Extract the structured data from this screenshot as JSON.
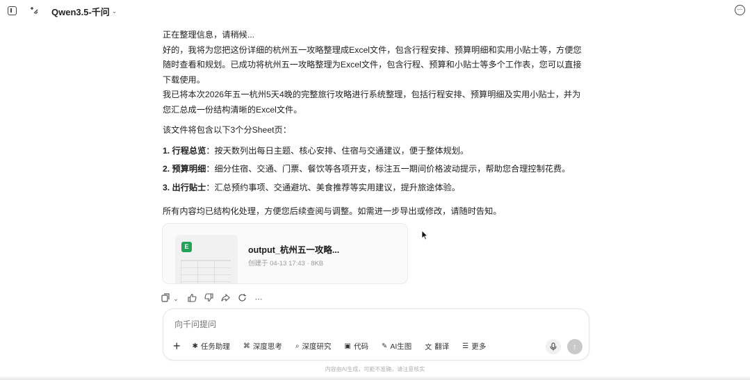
{
  "topbar": {
    "model_name": "Qwen3.5-千问",
    "chevron": "⌄",
    "icons": [
      "sidebar-toggle-icon",
      "new-chat-icon",
      "info-icon"
    ]
  },
  "message": {
    "status_line": "正在整理信息，请稍候...",
    "para1": "好的，我将为您把这份详细的杭州五一攻略整理成Excel文件，包含行程安排、预算明细和实用小贴士等，方便您随时查看和规划。已成功将杭州五一攻略整理为Excel文件，包含行程、预算和小贴士等多个工作表，您可以直接下载使用。",
    "para2": "我已将本次2026年五一杭州5天4晚的完整旅行攻略进行系统整理，包括行程安排、预算明细及实用小贴士，并为您汇总成一份结构清晰的Excel文件。",
    "sheets_intro": "该文件将包含以下3个分Sheet页：",
    "items": [
      {
        "label": "1. 行程总览",
        "text": "：按天数列出每日主题、核心安排、住宿与交通建议，便于整体规划。"
      },
      {
        "label": "2. 预算明细",
        "text": "：细分住宿、交通、门票、餐饮等各项开支，标注五一期间价格波动提示，帮助您合理控制花费。"
      },
      {
        "label": "3. 出行贴士",
        "text": "：汇总预约事项、交通避坑、美食推荐等实用建议，提升旅途体验。"
      }
    ],
    "closing": "所有内容均已结构化处理，方便您后续查阅与调整。如需进一步导出或修改，请随时告知。"
  },
  "file_card": {
    "badge": "E",
    "name": "output_杭州五一攻略...",
    "meta": "创建于 04-13 17:43 · 8KB",
    "badge_color": "#22a35a"
  },
  "actions": {
    "icons": [
      "copy-icon",
      "chevron-down-icon",
      "thumbs-up-icon",
      "thumbs-down-icon",
      "share-icon",
      "regenerate-icon",
      "more-icon"
    ]
  },
  "composer": {
    "placeholder": "向千问提问",
    "tools": [
      {
        "icon": "task-assistant-icon",
        "glyph": "✱",
        "label": "任务助理"
      },
      {
        "icon": "deep-think-icon",
        "glyph": "⌘",
        "label": "深度思考"
      },
      {
        "icon": "deep-research-icon",
        "glyph": "⌕",
        "label": "深度研究"
      },
      {
        "icon": "code-icon",
        "glyph": "▣",
        "label": "代码"
      },
      {
        "icon": "ai-image-icon",
        "glyph": "✎",
        "label": "AI生图"
      },
      {
        "icon": "translate-icon",
        "glyph": "文",
        "label": "翻译"
      },
      {
        "icon": "more-list-icon",
        "glyph": "☰",
        "label": "更多"
      }
    ]
  },
  "footer": {
    "disclaimer": "内容由AI生成，可能不准确，请注意核实"
  }
}
